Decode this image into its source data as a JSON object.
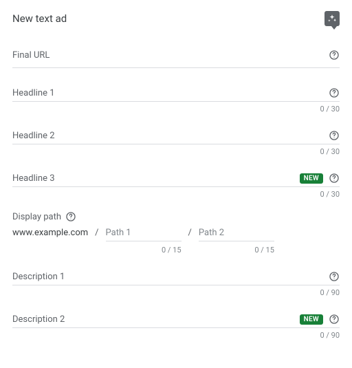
{
  "header": {
    "title": "New text ad"
  },
  "badges": {
    "new_label": "NEW"
  },
  "fields": {
    "final_url": {
      "label": "Final URL"
    },
    "headline1": {
      "label": "Headline 1",
      "counter": "0 / 30"
    },
    "headline2": {
      "label": "Headline 2",
      "counter": "0 / 30"
    },
    "headline3": {
      "label": "Headline 3",
      "counter": "0 / 30"
    },
    "description1": {
      "label": "Description 1",
      "counter": "0 / 90"
    },
    "description2": {
      "label": "Description 2",
      "counter": "0 / 90"
    }
  },
  "display_path": {
    "label": "Display path",
    "domain": "www.example.com",
    "path1_placeholder": "Path 1",
    "path2_placeholder": "Path 2",
    "path1_counter": "0 / 15",
    "path2_counter": "0 / 15"
  }
}
